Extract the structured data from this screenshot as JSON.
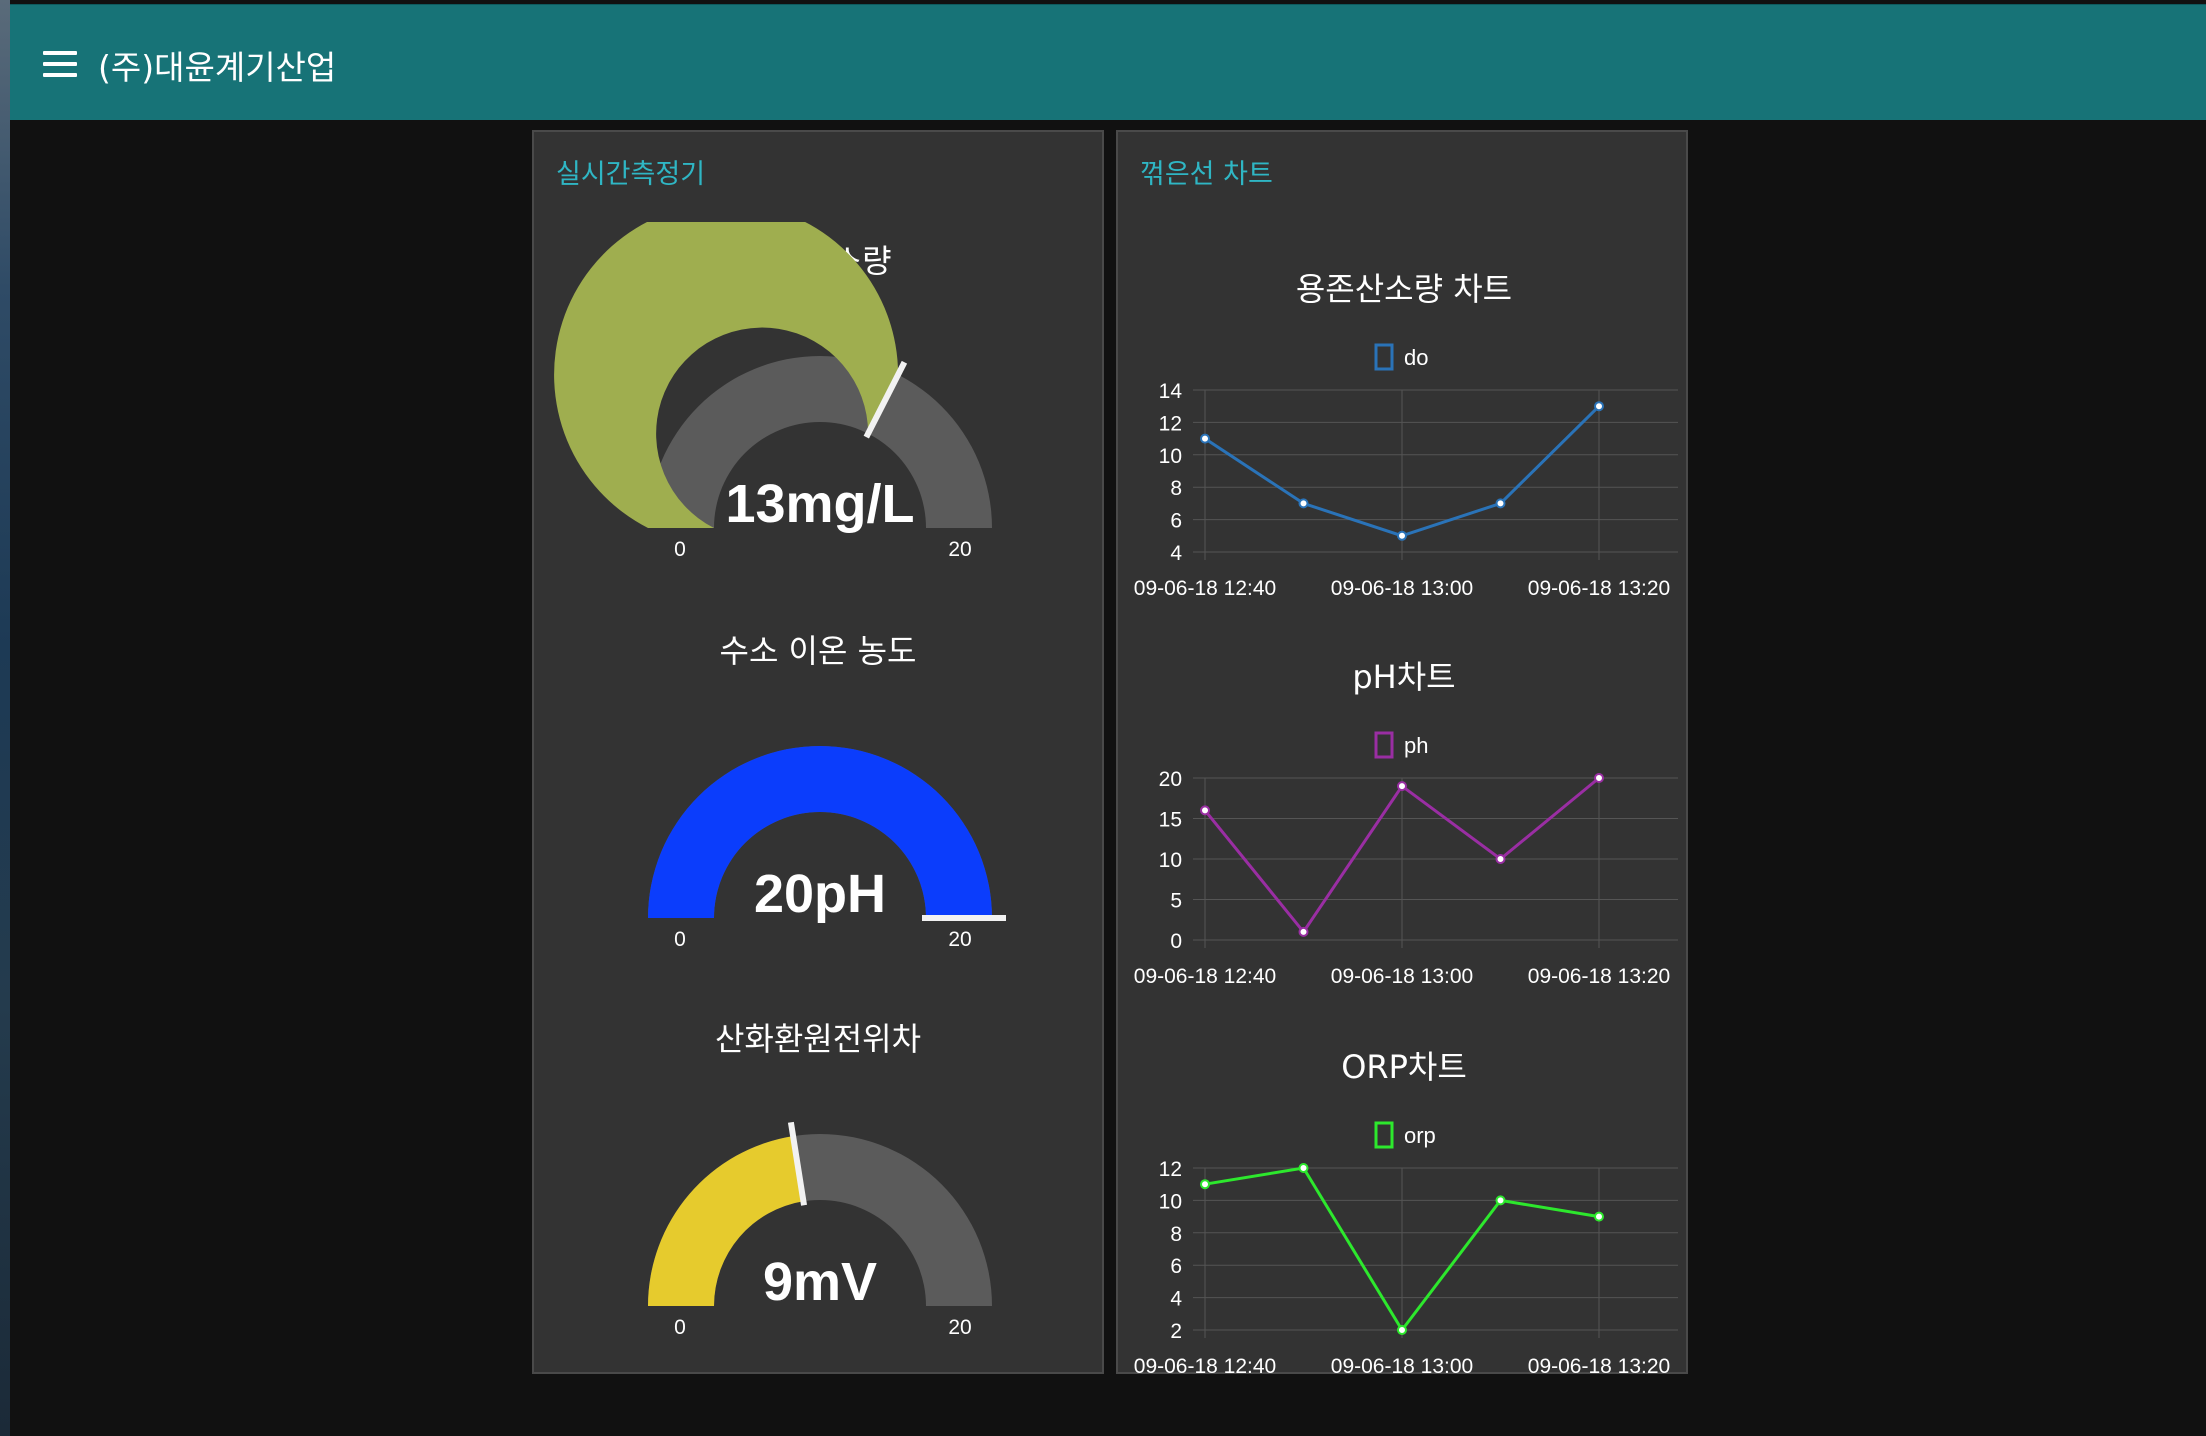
{
  "header": {
    "title": "(주)대윤계기산업",
    "menu_icon": "hamburger-menu-icon"
  },
  "realtime_panel": {
    "title": "실시간측정기",
    "gauges": [
      {
        "label": "용존산소량",
        "value": 13,
        "display": "13mg/L",
        "min": "0",
        "max": "20",
        "color": "#9fae4f"
      },
      {
        "label": "수소 이온 농도",
        "value": 20,
        "display": "20pH",
        "min": "0",
        "max": "20",
        "color": "#0b3dfc"
      },
      {
        "label": "산화환원전위차",
        "value": 9,
        "display": "9mV",
        "min": "0",
        "max": "20",
        "color": "#e6cb2d"
      }
    ]
  },
  "chart_panel": {
    "title": "꺾은선 차트",
    "charts": [
      {
        "title": "용존산소량 차트",
        "legend": "do",
        "color": "#2a73b8"
      },
      {
        "title": "pH차트",
        "legend": "ph",
        "color": "#9a2ea3"
      },
      {
        "title": "ORP차트",
        "legend": "orp",
        "color": "#2de82d"
      }
    ]
  },
  "chart_data": [
    {
      "type": "line",
      "title": "용존산소량 차트",
      "x": [
        "09-06-18 12:40",
        "09-06-18 12:50",
        "09-06-18 13:00",
        "09-06-18 13:10",
        "09-06-18 13:20"
      ],
      "x_ticks": [
        "09-06-18 12:40",
        "09-06-18 13:00",
        "09-06-18 13:20"
      ],
      "series": [
        {
          "name": "do",
          "values": [
            11,
            7,
            5,
            7,
            13
          ]
        }
      ],
      "ylim": [
        4,
        14
      ],
      "y_ticks": [
        4,
        6,
        8,
        10,
        12,
        14
      ],
      "grid": true,
      "legend": "top-center"
    },
    {
      "type": "line",
      "title": "pH차트",
      "x": [
        "09-06-18 12:40",
        "09-06-18 12:50",
        "09-06-18 13:00",
        "09-06-18 13:10",
        "09-06-18 13:20"
      ],
      "x_ticks": [
        "09-06-18 12:40",
        "09-06-18 13:00",
        "09-06-18 13:20"
      ],
      "series": [
        {
          "name": "ph",
          "values": [
            16,
            1,
            19,
            10,
            20
          ]
        }
      ],
      "ylim": [
        0,
        20
      ],
      "y_ticks": [
        0,
        5,
        10,
        15,
        20
      ],
      "grid": true,
      "legend": "top-center"
    },
    {
      "type": "line",
      "title": "ORP차트",
      "x": [
        "09-06-18 12:40",
        "09-06-18 12:50",
        "09-06-18 13:00",
        "09-06-18 13:10",
        "09-06-18 13:20"
      ],
      "x_ticks": [
        "09-06-18 12:40",
        "09-06-18 13:00",
        "09-06-18 13:20"
      ],
      "series": [
        {
          "name": "orp",
          "values": [
            11,
            12,
            2,
            10,
            9
          ]
        }
      ],
      "ylim": [
        2,
        12
      ],
      "y_ticks": [
        2,
        4,
        6,
        8,
        10,
        12
      ],
      "grid": true,
      "legend": "top-center"
    }
  ]
}
